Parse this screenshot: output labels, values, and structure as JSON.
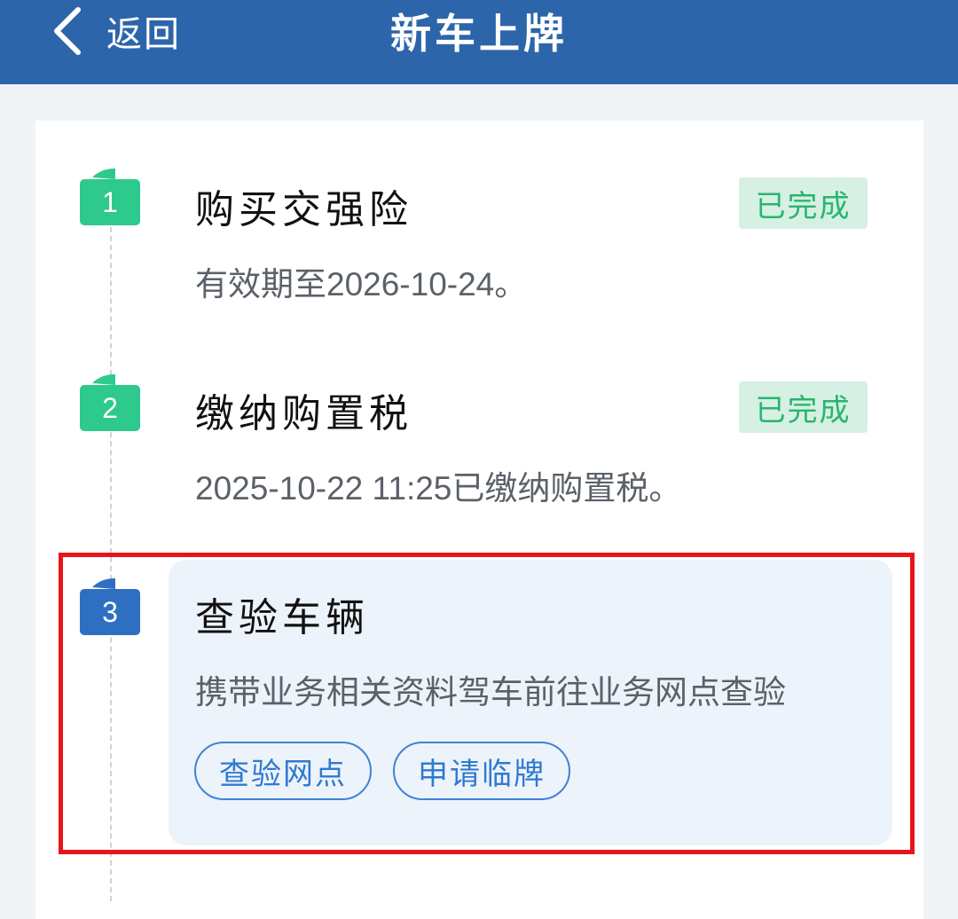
{
  "header": {
    "back_label": "返回",
    "title": "新车上牌"
  },
  "steps": [
    {
      "number": "1",
      "title": "购买交强险",
      "description": "有效期至2026-10-24。",
      "status": "已完成",
      "badge_color": "#2ec98d"
    },
    {
      "number": "2",
      "title": "缴纳购置税",
      "description": "2025-10-22 11:25已缴纳购置税。",
      "status": "已完成",
      "badge_color": "#2ec98d"
    },
    {
      "number": "3",
      "title": "查验车辆",
      "description": "携带业务相关资料驾车前往业务网点查验",
      "badge_color": "#2f6fc2",
      "actions": [
        "查验网点",
        "申请临牌"
      ]
    }
  ],
  "colors": {
    "header_bg": "#2d65aa",
    "done_badge": "#2ec98d",
    "active_badge": "#2f6fc2",
    "status_bg": "#d6f0e3",
    "status_text": "#28b56f",
    "highlight_frame": "#e8141a",
    "action_accent": "#2f7ad1"
  }
}
